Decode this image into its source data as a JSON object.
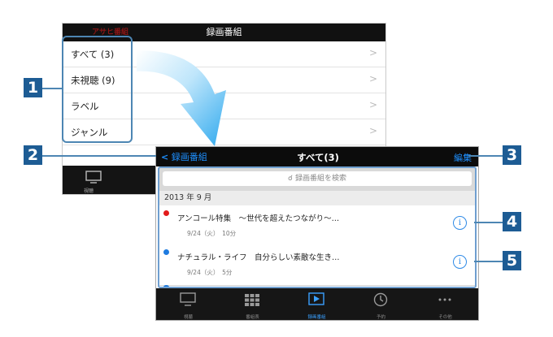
{
  "back_screen": {
    "header_title": "録画番組",
    "logo_text": "アサヒ番組",
    "rows": [
      {
        "label": "すべて (3)"
      },
      {
        "label": "未視聴 (9)"
      },
      {
        "label": "ラベル"
      },
      {
        "label": "ジャンル"
      }
    ],
    "tab_label": "視聴"
  },
  "front_screen": {
    "nav": {
      "back_label": "録画番組",
      "title": "すべて(3)",
      "edit_label": "編集"
    },
    "search": {
      "placeholder": "録画番組を検索"
    },
    "section_header": "2013 年 9 月",
    "programs": [
      {
        "title": "アンコール特集　～世代を超えたつながり～…",
        "meta": "9/24（火）　10分",
        "dot_color": "#e21b1b"
      },
      {
        "title": "ナチュラル・ライフ　自分らしい素敵な生き…",
        "meta": "9/24（火）　5分",
        "dot_color": "#1e7be0"
      }
    ],
    "tabbar": [
      {
        "label": "視聴",
        "icon": "tv-icon",
        "active": false
      },
      {
        "label": "番組表",
        "icon": "grid-icon",
        "active": false
      },
      {
        "label": "録画番組",
        "icon": "play-icon",
        "active": true
      },
      {
        "label": "予約",
        "icon": "clock-icon",
        "active": false
      },
      {
        "label": "その他",
        "icon": "more-icon",
        "active": false
      }
    ]
  },
  "markers": [
    "1",
    "2",
    "3",
    "4",
    "5"
  ],
  "colors": {
    "marker_bg": "#1d5c94",
    "accent": "#1e90ff",
    "record_dot_red": "#e21b1b",
    "record_dot_blue": "#1e7be0"
  }
}
